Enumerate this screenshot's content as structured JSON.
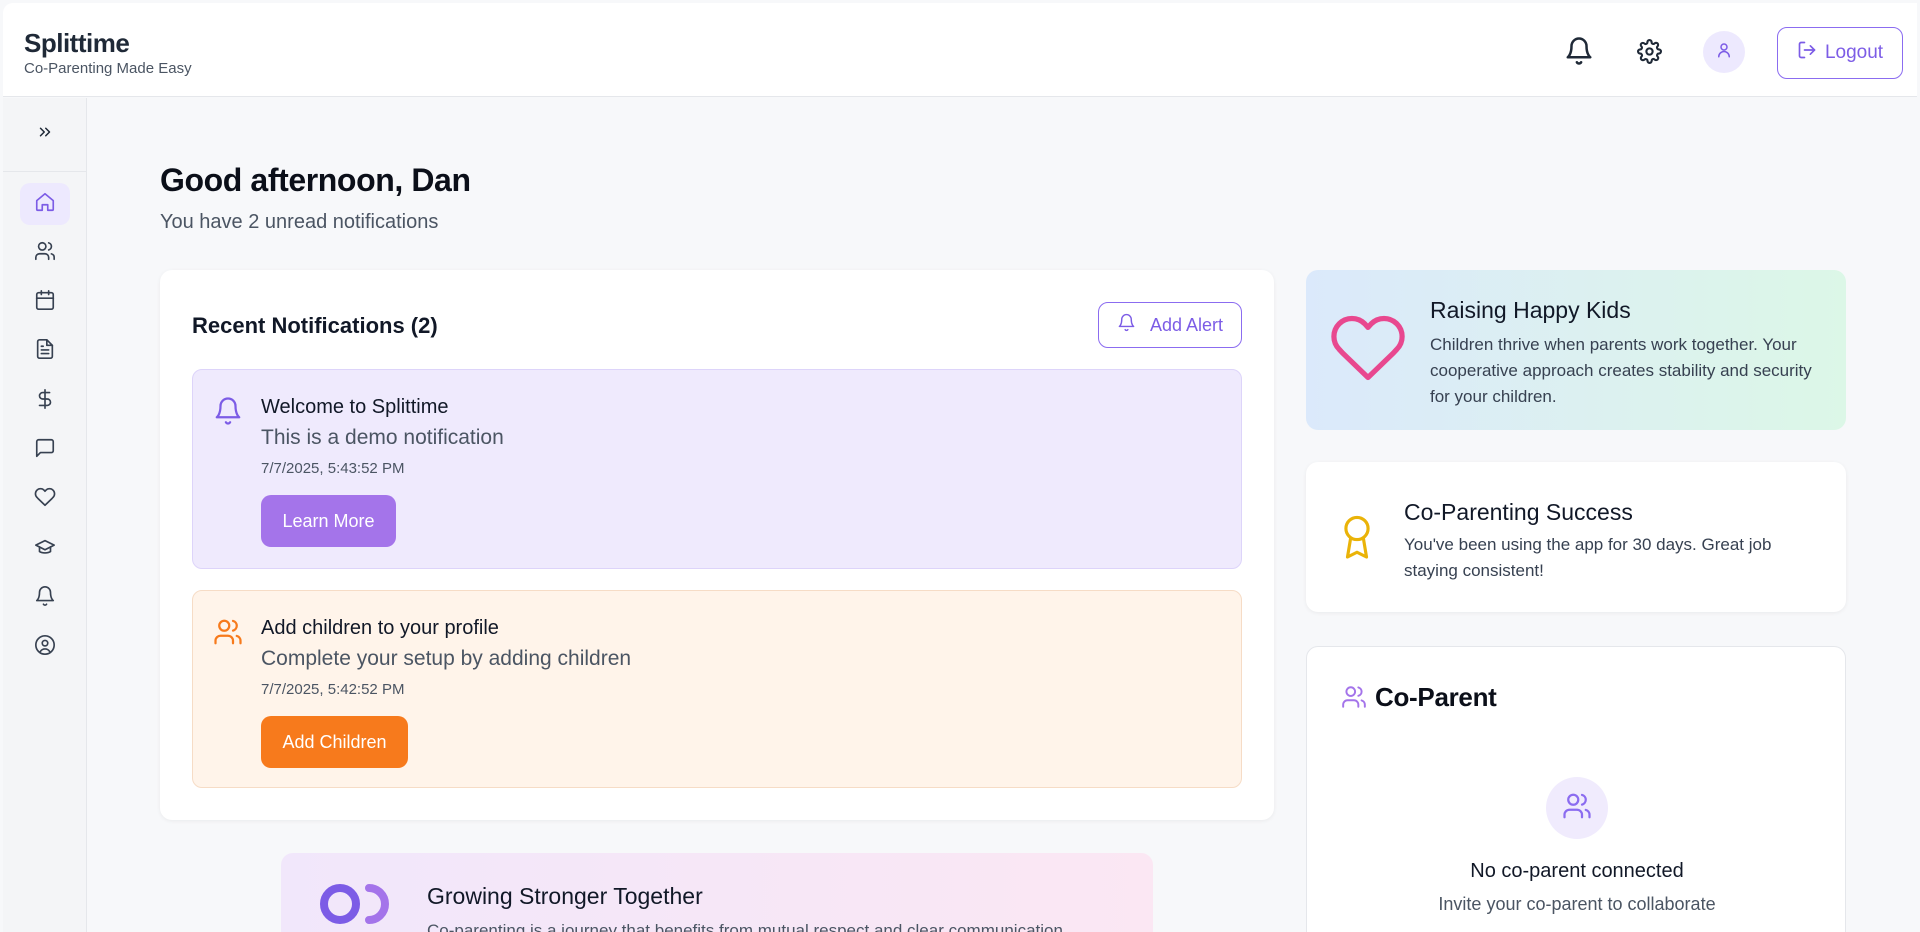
{
  "app": {
    "name": "Splittime",
    "tagline": "Co-Parenting Made Easy"
  },
  "header": {
    "notifications_icon": "bell-icon",
    "settings_icon": "gear-icon",
    "avatar_icon": "user-icon",
    "logout_label": "Logout"
  },
  "sidebar": {
    "toggle_icon": "chevrons-right-icon",
    "items": [
      {
        "icon": "home-icon",
        "active": true
      },
      {
        "icon": "users-icon",
        "active": false
      },
      {
        "icon": "calendar-icon",
        "active": false
      },
      {
        "icon": "document-icon",
        "active": false
      },
      {
        "icon": "dollar-icon",
        "active": false
      },
      {
        "icon": "message-icon",
        "active": false
      },
      {
        "icon": "heart-icon",
        "active": false
      },
      {
        "icon": "graduation-cap-icon",
        "active": false
      },
      {
        "icon": "bell-icon",
        "active": false
      },
      {
        "icon": "user-circle-icon",
        "active": false
      }
    ]
  },
  "main": {
    "greeting": "Good afternoon, Dan",
    "subtitle": "You have 2 unread notifications",
    "notifications": {
      "title": "Recent Notifications (2)",
      "add_alert_label": "Add Alert",
      "items": [
        {
          "icon": "bell-icon",
          "title": "Welcome to Splittime",
          "body": "This is a demo notification",
          "time": "7/7/2025, 5:43:52 PM",
          "action": "Learn More"
        },
        {
          "icon": "users-icon",
          "title": "Add children to your profile",
          "body": "Complete your setup by adding children",
          "time": "7/7/2025, 5:42:52 PM",
          "action": "Add Children"
        }
      ]
    },
    "growing": {
      "title": "Growing Stronger Together",
      "text": "Co-parenting is a journey that benefits from mutual respect and clear communication."
    }
  },
  "right": {
    "happy": {
      "title": "Raising Happy Kids",
      "text": "Children thrive when parents work together. Your cooperative approach creates stability and security for your children."
    },
    "success": {
      "title": "Co-Parenting Success",
      "text": "You've been using the app for 30 days. Great job staying consistent!"
    },
    "coparent": {
      "title": "Co-Parent",
      "empty_title": "No co-parent connected",
      "empty_text": "Invite your co-parent to collaborate"
    }
  },
  "colors": {
    "accent": "#7c5ce6",
    "learn_button": "#a474ea",
    "orange_button": "#f77a1c",
    "heart": "#e8488f",
    "award": "#eab308"
  }
}
